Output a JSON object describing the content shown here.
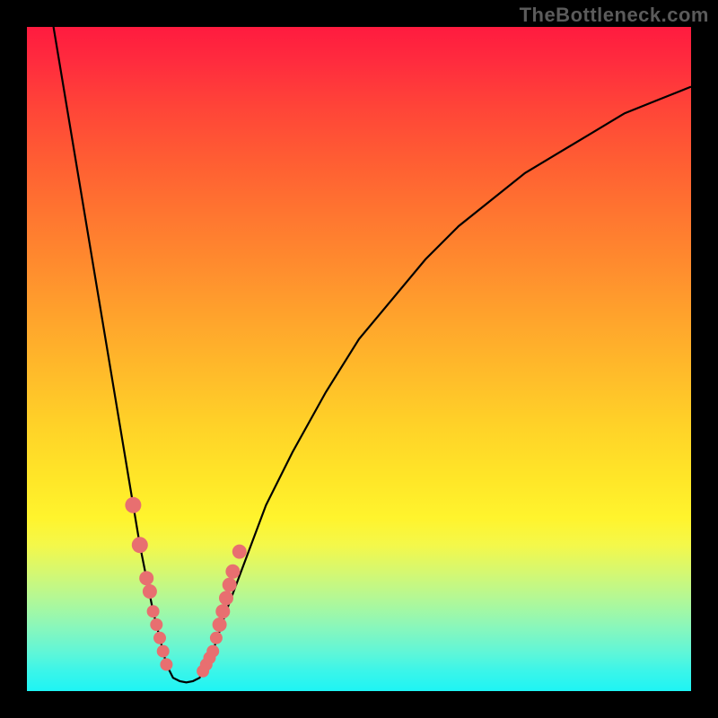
{
  "attribution": "TheBottleneck.com",
  "colors": {
    "background": "#000000",
    "curve": "#000000",
    "marker": "#e86f70"
  },
  "chart_data": {
    "type": "line",
    "title": "",
    "xlabel": "",
    "ylabel": "",
    "xlim": [
      0,
      100
    ],
    "ylim": [
      0,
      100
    ],
    "grid": false,
    "legend": false,
    "series": [
      {
        "name": "left-branch",
        "x": [
          4,
          6,
          8,
          10,
          12,
          14,
          15,
          16,
          17,
          18,
          19,
          20,
          21,
          22
        ],
        "values": [
          100,
          88,
          76,
          64,
          52,
          40,
          34,
          28,
          22,
          17,
          12,
          8,
          4,
          2
        ]
      },
      {
        "name": "valley-floor",
        "x": [
          22,
          23,
          24,
          25,
          26
        ],
        "values": [
          2,
          1.5,
          1.3,
          1.5,
          2
        ]
      },
      {
        "name": "right-branch",
        "x": [
          26,
          28,
          30,
          33,
          36,
          40,
          45,
          50,
          55,
          60,
          65,
          70,
          75,
          80,
          85,
          90,
          95,
          100
        ],
        "values": [
          2,
          6,
          12,
          20,
          28,
          36,
          45,
          53,
          59,
          65,
          70,
          74,
          78,
          81,
          84,
          87,
          89,
          91
        ]
      }
    ],
    "markers": {
      "name": "highlighted-points",
      "x": [
        16,
        17,
        18,
        18.5,
        19,
        19.5,
        20,
        20.5,
        21,
        26.5,
        27,
        27.5,
        28,
        28.5,
        29,
        29.5,
        30,
        30.5,
        31,
        32
      ],
      "values": [
        28,
        22,
        17,
        15,
        12,
        10,
        8,
        6,
        4,
        3,
        4,
        5,
        6,
        8,
        10,
        12,
        14,
        16,
        18,
        21
      ],
      "sizes": [
        9,
        9,
        8,
        8,
        7,
        7,
        7,
        7,
        7,
        7,
        7,
        7,
        7,
        7,
        8,
        8,
        8,
        8,
        8,
        8
      ]
    }
  }
}
